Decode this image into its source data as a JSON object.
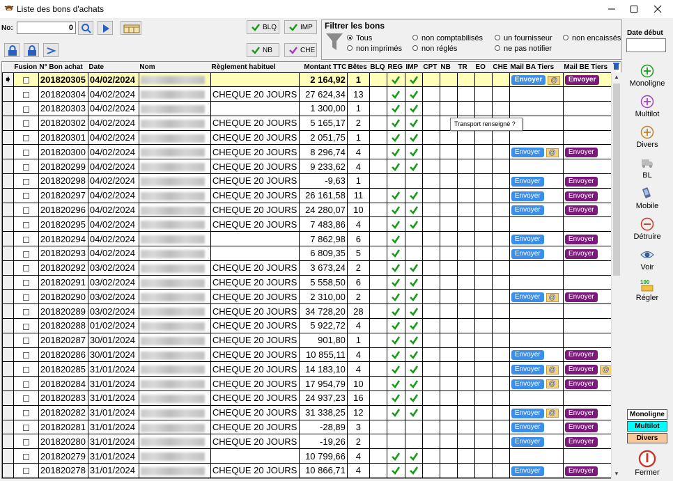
{
  "window": {
    "title": "Liste des bons d'achats"
  },
  "toolbar": {
    "no_label": "No:",
    "no_value": "0",
    "blq_label": "BLQ",
    "imp_label": "IMP",
    "nb_label": "NB",
    "che_label": "CHE"
  },
  "filter": {
    "title": "Filtrer les bons",
    "options": [
      "Tous",
      "non comptabilisés",
      "un fournisseur",
      "non encaissés",
      "non imprimés",
      "non réglés",
      "ne pas notifier"
    ],
    "selected": "Tous"
  },
  "date_debut": {
    "label": "Date début",
    "value": ""
  },
  "table": {
    "headers": [
      "Fusion",
      "N° Bon achat",
      "Date",
      "Nom",
      "Règlement habituel",
      "Montant TTC",
      "Bêtes",
      "BLQ",
      "REG",
      "IMP",
      "CPT",
      "NB",
      "TR",
      "EO",
      "CHE",
      "Mail BA Tiers",
      "Mail BE Tiers"
    ],
    "send_label": "Envoyer",
    "rows": [
      {
        "num": "201820305",
        "date": "04/02/2024",
        "reglement": "",
        "montant": "2 164,92",
        "betes": "1",
        "reg": true,
        "imp": true,
        "ba": "send_mail",
        "be": "send"
      },
      {
        "num": "201820304",
        "date": "04/02/2024",
        "reglement": "CHEQUE 20 JOURS",
        "montant": "27 624,34",
        "betes": "13",
        "reg": true,
        "imp": true,
        "ba": "",
        "be": ""
      },
      {
        "num": "201820303",
        "date": "04/02/2024",
        "reglement": "",
        "montant": "1 300,00",
        "betes": "1",
        "reg": true,
        "imp": true,
        "ba": "",
        "be": ""
      },
      {
        "num": "201820302",
        "date": "04/02/2024",
        "reglement": "CHEQUE 20 JOURS",
        "montant": "5 165,17",
        "betes": "2",
        "reg": true,
        "imp": true,
        "ba": "",
        "be": ""
      },
      {
        "num": "201820301",
        "date": "04/02/2024",
        "reglement": "CHEQUE 20 JOURS",
        "montant": "2 051,75",
        "betes": "1",
        "reg": true,
        "imp": true,
        "ba": "",
        "be": ""
      },
      {
        "num": "201820300",
        "date": "04/02/2024",
        "reglement": "CHEQUE 20 JOURS",
        "montant": "8 296,74",
        "betes": "4",
        "reg": true,
        "imp": true,
        "ba": "send_mail",
        "be": "send"
      },
      {
        "num": "201820299",
        "date": "04/02/2024",
        "reglement": "CHEQUE 20 JOURS",
        "montant": "9 233,62",
        "betes": "4",
        "reg": true,
        "imp": true,
        "ba": "",
        "be": ""
      },
      {
        "num": "201820298",
        "date": "04/02/2024",
        "reglement": "CHEQUE 20 JOURS",
        "montant": "-9,63",
        "betes": "1",
        "reg": false,
        "imp": false,
        "ba": "send",
        "be": "send"
      },
      {
        "num": "201820297",
        "date": "04/02/2024",
        "reglement": "CHEQUE 20 JOURS",
        "montant": "26 161,58",
        "betes": "11",
        "reg": true,
        "imp": true,
        "ba": "send",
        "be": "send"
      },
      {
        "num": "201820296",
        "date": "04/02/2024",
        "reglement": "CHEQUE 20 JOURS",
        "montant": "24 280,07",
        "betes": "10",
        "reg": true,
        "imp": true,
        "ba": "send",
        "be": "send"
      },
      {
        "num": "201820295",
        "date": "04/02/2024",
        "reglement": "CHEQUE 20 JOURS",
        "montant": "7 483,86",
        "betes": "4",
        "reg": true,
        "imp": true,
        "ba": "",
        "be": ""
      },
      {
        "num": "201820294",
        "date": "04/02/2024",
        "reglement": "",
        "montant": "7 862,98",
        "betes": "6",
        "reg": true,
        "imp": false,
        "ba": "send",
        "be": "send"
      },
      {
        "num": "201820293",
        "date": "04/02/2024",
        "reglement": "",
        "montant": "6 809,35",
        "betes": "5",
        "reg": true,
        "imp": false,
        "ba": "send",
        "be": "send"
      },
      {
        "num": "201820292",
        "date": "03/02/2024",
        "reglement": "CHEQUE 20 JOURS",
        "montant": "3 673,24",
        "betes": "2",
        "reg": true,
        "imp": true,
        "ba": "",
        "be": ""
      },
      {
        "num": "201820291",
        "date": "03/02/2024",
        "reglement": "CHEQUE 20 JOURS",
        "montant": "5 558,50",
        "betes": "6",
        "reg": true,
        "imp": true,
        "ba": "",
        "be": ""
      },
      {
        "num": "201820290",
        "date": "03/02/2024",
        "reglement": "CHEQUE 20 JOURS",
        "montant": "2 310,00",
        "betes": "2",
        "reg": true,
        "imp": true,
        "ba": "send_mail",
        "be": "send"
      },
      {
        "num": "201820289",
        "date": "03/02/2024",
        "reglement": "CHEQUE 20 JOURS",
        "montant": "34 728,20",
        "betes": "28",
        "reg": true,
        "imp": true,
        "ba": "",
        "be": ""
      },
      {
        "num": "201820288",
        "date": "01/02/2024",
        "reglement": "CHEQUE 20 JOURS",
        "montant": "5 922,72",
        "betes": "4",
        "reg": true,
        "imp": true,
        "ba": "",
        "be": ""
      },
      {
        "num": "201820287",
        "date": "30/01/2024",
        "reglement": "CHEQUE 20 JOURS",
        "montant": "901,80",
        "betes": "1",
        "reg": true,
        "imp": true,
        "ba": "",
        "be": ""
      },
      {
        "num": "201820286",
        "date": "30/01/2024",
        "reglement": "CHEQUE 20 JOURS",
        "montant": "10 855,11",
        "betes": "4",
        "reg": true,
        "imp": true,
        "ba": "send",
        "be": "send"
      },
      {
        "num": "201820285",
        "date": "31/01/2024",
        "reglement": "CHEQUE 20 JOURS",
        "montant": "14 183,10",
        "betes": "4",
        "reg": true,
        "imp": true,
        "ba": "send_mail",
        "be": "send_mail"
      },
      {
        "num": "201820284",
        "date": "31/01/2024",
        "reglement": "CHEQUE 20 JOURS",
        "montant": "17 954,79",
        "betes": "10",
        "reg": true,
        "imp": true,
        "ba": "send_mail",
        "be": "send"
      },
      {
        "num": "201820283",
        "date": "31/01/2024",
        "reglement": "CHEQUE 20 JOURS",
        "montant": "24 937,23",
        "betes": "16",
        "reg": true,
        "imp": true,
        "ba": "",
        "be": ""
      },
      {
        "num": "201820282",
        "date": "31/01/2024",
        "reglement": "CHEQUE 20 JOURS",
        "montant": "31 338,25",
        "betes": "12",
        "reg": true,
        "imp": true,
        "ba": "send_mail",
        "be": "send"
      },
      {
        "num": "201820281",
        "date": "31/01/2024",
        "reglement": "CHEQUE 20 JOURS",
        "montant": "-28,89",
        "betes": "3",
        "reg": false,
        "imp": false,
        "ba": "send",
        "be": "send"
      },
      {
        "num": "201820280",
        "date": "31/01/2024",
        "reglement": "CHEQUE 20 JOURS",
        "montant": "-19,26",
        "betes": "2",
        "reg": false,
        "imp": false,
        "ba": "send",
        "be": "send"
      },
      {
        "num": "201820279",
        "date": "31/01/2024",
        "reglement": "",
        "montant": "10 799,66",
        "betes": "4",
        "reg": true,
        "imp": true,
        "ba": "",
        "be": ""
      },
      {
        "num": "201820278",
        "date": "31/01/2024",
        "reglement": "CHEQUE 20 JOURS",
        "montant": "10 866,71",
        "betes": "4",
        "reg": true,
        "imp": true,
        "ba": "send",
        "be": "send"
      }
    ]
  },
  "tooltip": "Transport renseigné ?",
  "side": {
    "monoligne": "Monoligne",
    "multilot": "Multilot",
    "divers": "Divers",
    "bl": "BL",
    "mobile": "Mobile",
    "detruire": "Détruire",
    "voir": "Voir",
    "regler": "Régler",
    "fermer": "Fermer"
  },
  "legend": {
    "monoligne": "Monoligne",
    "multilot": "Multilot",
    "divers": "Divers",
    "multilot_color": "#00ffff",
    "divers_color": "#f8c89a"
  },
  "colors": {
    "selected_row": "#ffffb8",
    "send_blue": "#3c8ee8",
    "send_purple": "#7b1a7b",
    "check_green": "#1a9a1a"
  }
}
